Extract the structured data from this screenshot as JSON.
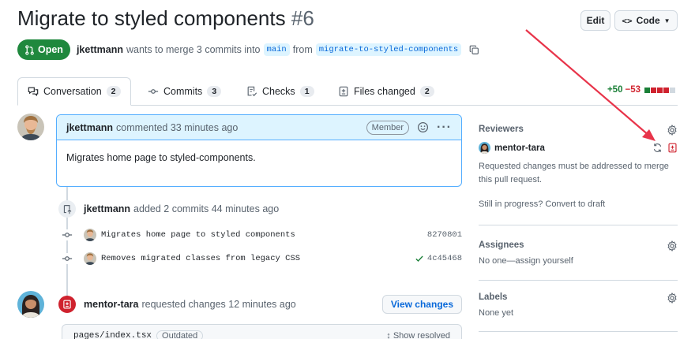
{
  "header": {
    "title": "Migrate to styled components",
    "number": "#6",
    "edit_label": "Edit",
    "code_label": "Code"
  },
  "meta": {
    "state": "Open",
    "author": "jkettmann",
    "summary": "wants to merge 3 commits into",
    "base_branch": "main",
    "from_word": "from",
    "head_branch": "migrate-to-styled-components"
  },
  "tabs": [
    {
      "label": "Conversation",
      "count": "2",
      "icon": "comment-discussion-icon"
    },
    {
      "label": "Commits",
      "count": "3",
      "icon": "git-commit-icon"
    },
    {
      "label": "Checks",
      "count": "1",
      "icon": "checklist-icon"
    },
    {
      "label": "Files changed",
      "count": "2",
      "icon": "file-diff-icon"
    }
  ],
  "diffstat": {
    "additions": "+50",
    "deletions": "−53",
    "blocks": [
      "#1a7f37",
      "#cf222e",
      "#cf222e",
      "#cf222e",
      "#d1d9e0"
    ]
  },
  "comment": {
    "author": "jkettmann",
    "action": "commented 33 minutes ago",
    "role": "Member",
    "body": "Migrates home page to styled-components."
  },
  "commits_event": {
    "author": "jkettmann",
    "action": "added 2 commits 44 minutes ago"
  },
  "commits": [
    {
      "message": "Migrates home page to styled components",
      "sha": "8270801",
      "verified": false
    },
    {
      "message": "Removes migrated classes from legacy CSS",
      "sha": "4c45468",
      "verified": true
    }
  ],
  "review_event": {
    "author": "mentor-tara",
    "action": "requested changes 12 minutes ago",
    "button": "View changes"
  },
  "file": {
    "path": "pages/index.tsx",
    "badge": "Outdated",
    "show_resolved": "Show resolved"
  },
  "sidebar": {
    "reviewers_title": "Reviewers",
    "reviewer": "mentor-tara",
    "requested_note": "Requested changes must be addressed to merge this pull request.",
    "in_progress": "Still in progress? Convert to draft",
    "assignees_title": "Assignees",
    "assignees_value": "No one—assign yourself",
    "labels_title": "Labels",
    "labels_value": "None yet"
  },
  "colors": {
    "open_green": "#1f883d",
    "accent_blue": "#0969da",
    "danger_red": "#cf222e",
    "annotation_arrow": "#e8344a"
  }
}
